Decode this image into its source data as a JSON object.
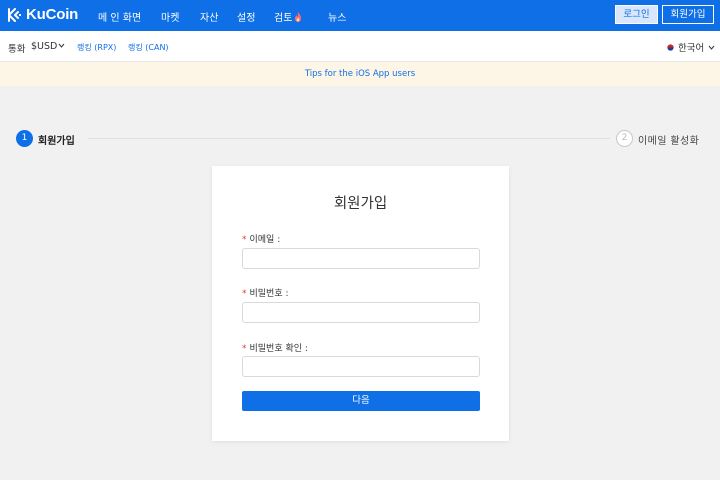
{
  "app": {
    "brand": "KuCoin",
    "brand_color": "#0f6fe6"
  },
  "nav": {
    "items": [
      {
        "label": "메 인 화면"
      },
      {
        "label": "마켓"
      },
      {
        "label": "자산"
      },
      {
        "label": "설정"
      },
      {
        "label": "검토",
        "icon": "fire-icon"
      },
      {
        "label": "뉴스"
      }
    ],
    "login_label": "로그인",
    "signup_label": "회원가입"
  },
  "subbar": {
    "currency_label": "통화",
    "currency_value": "$USD",
    "tickers": [
      "랭킹 (RPX)",
      "랭킹 (CAN)"
    ],
    "language": "한국어"
  },
  "notice": {
    "text": "Tips for the iOS App users"
  },
  "steps": [
    {
      "number": "1",
      "label": "회원가입",
      "active": true
    },
    {
      "number": "2",
      "label": "이메일 활성화",
      "active": false
    }
  ],
  "form": {
    "title": "회원가입",
    "fields": [
      {
        "label": "이메일 :",
        "value": "",
        "required": true
      },
      {
        "label": "비밀번호 :",
        "value": "",
        "required": true
      },
      {
        "label": "비밀번호 확인 :",
        "value": "",
        "required": true
      }
    ],
    "submit_label": "다음"
  },
  "colors": {
    "accent": "#0f6fe6",
    "notice_bg": "#fdf6e6",
    "page_bg": "#f1f1f1",
    "required": "#e53935"
  }
}
